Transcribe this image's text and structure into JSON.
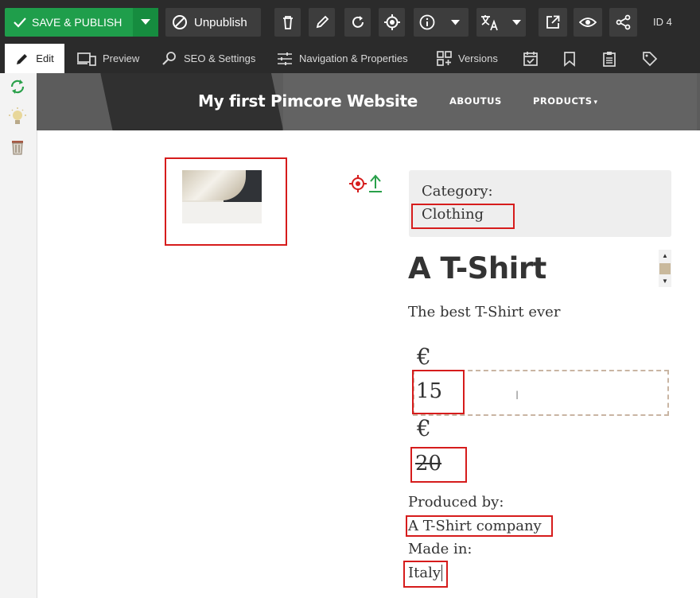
{
  "toolbar": {
    "save_publish": "SAVE & PUBLISH",
    "unpublish": "Unpublish",
    "id": "ID 4",
    "icons": [
      "delete-icon",
      "edit-icon",
      "reload-icon",
      "target-icon",
      "info-icon",
      "translate-icon",
      "open-external-icon",
      "preview-eye-icon",
      "share-icon"
    ]
  },
  "tabs": [
    {
      "label": "Edit",
      "icon": "pencil-icon"
    },
    {
      "label": "Preview",
      "icon": "devices-icon"
    },
    {
      "label": "SEO & Settings",
      "icon": "search-gear-icon"
    },
    {
      "label": "Navigation & Properties",
      "icon": "sliders-icon"
    },
    {
      "label": "Versions",
      "icon": "versions-icon"
    },
    {
      "label": "",
      "icon": "schedule-icon"
    },
    {
      "label": "",
      "icon": "bookmark-icon"
    },
    {
      "label": "",
      "icon": "clipboard-icon"
    },
    {
      "label": "",
      "icon": "tag-icon"
    }
  ],
  "sidebar": [
    "refresh-icon",
    "lightbulb-icon",
    "trash-icon"
  ],
  "site": {
    "title": "My first Pimcore Website",
    "nav": [
      "ABOUTUS",
      "PRODUCTS"
    ]
  },
  "product": {
    "category_label": "Category:",
    "category": "Clothing",
    "title": "A T-Shirt",
    "description": "The best T-Shirt ever",
    "currency": "€",
    "price": "15",
    "old_currency": "€",
    "old_price": "20",
    "produced_by_label": "Produced by:",
    "producer": "A T-Shirt company",
    "made_in_label": "Made in:",
    "country": "Italy"
  },
  "colors": {
    "toolbar_bg": "#2b2b2b",
    "save_green": "#1f9e4b",
    "highlight_red": "#d61c1c",
    "editable_dash": "#c9b5a3"
  }
}
